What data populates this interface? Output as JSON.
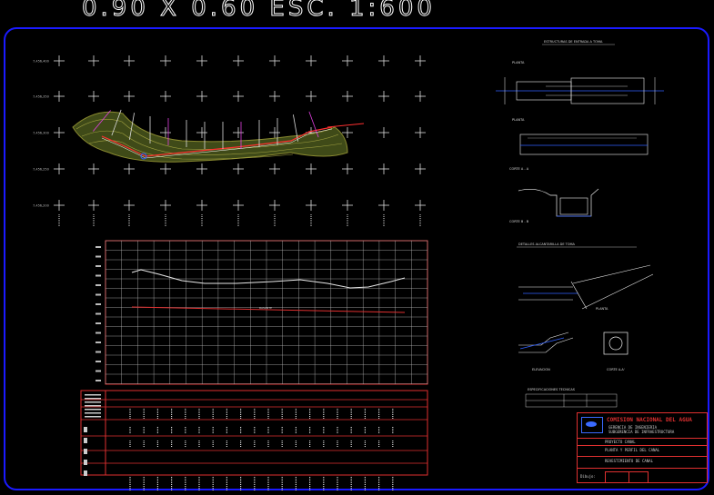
{
  "header": {
    "scale_text": "0.90  X  0.60    ESC.  1:600"
  },
  "colors": {
    "border": "#1a1aff",
    "title_red": "#e03030",
    "axis": "#e03030",
    "terrain": "#6b7a2a",
    "contour": "#c0a060",
    "section_marks": "#e040e0"
  },
  "plan": {
    "grid_label_y": [
      "7,456,400",
      "7,456,350",
      "7,456,300",
      "7,456,250",
      "7,456,200"
    ]
  },
  "profile": {
    "ground_line": "CANAL",
    "design_line": "RASANTE"
  },
  "details": {
    "title_1": "ESTRUCTURAS DE ENTRADA A TOMA",
    "label_planta": "PLANTA",
    "label_planta2": "PLANTA",
    "label_corte_a": "CORTE A - A",
    "label_corte_b": "CORTE B - B",
    "title_2": "DETALLES ALCANTARILLA DE TOMA",
    "label_planta3": "PLANTA",
    "label_elev": "ELEVACION",
    "label_corte_aa": "CORTE A-A'",
    "note": "ESPECIFICACIONES TECNICAS"
  },
  "titleblock": {
    "org": "COMISION NACIONAL DEL AGUA",
    "line1": "GERENCIA DE INGENIERIA",
    "line2": "SUBGERENCIA DE INFRAESTRUCTURA",
    "project": "PROYECTO CANAL",
    "sheet_title": "PLANTA Y PERFIL DEL CANAL",
    "sub_title": "REVESTIMIENTO DE CANAL",
    "drawn": "Dibujo:"
  }
}
